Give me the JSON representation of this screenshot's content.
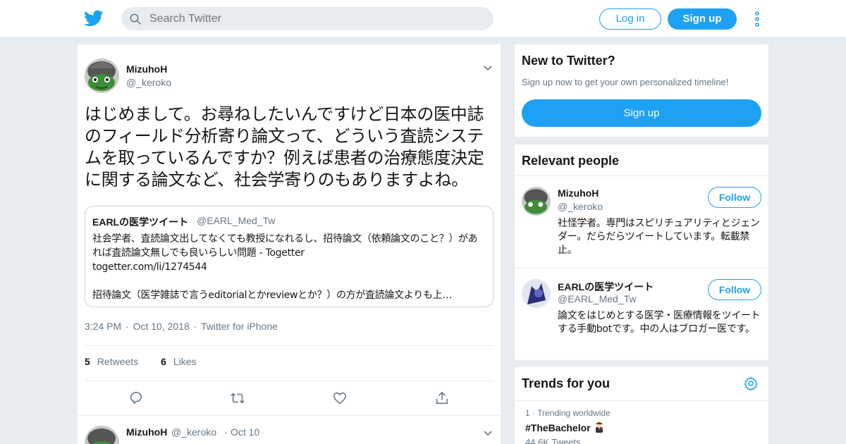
{
  "header": {
    "search_placeholder": "Search Twitter",
    "login_label": "Log in",
    "signup_label": "Sign up"
  },
  "tweet": {
    "author_name": "MizuhoH",
    "author_handle": "@_keroko",
    "text": "はじめまして。お尋ねしたいんですけど日本の医中誌のフィールド分析寄り論文って、どういう査読システムを取っているんですか？例えば患者の治療態度決定に関する論文など、社会学寄りのもありますよね。",
    "quote": {
      "name": "EARLの医学ツイート",
      "handle": "@EARL_Med_Tw",
      "text": "社会学者、査読論文出してなくても教授になれるし、招待論文（依頼論文のこと？）があれば査読論文無しでも良いらしい問題 - Togetter\ntogetter.com/li/1274544\n\n招待論文（医学雑誌で言うeditorialとかreviewとか？）の方が査読論文よりも上…"
    },
    "time": "3:24 PM",
    "date": "Oct 10, 2018",
    "source": "Twitter for iPhone",
    "retweets_count": "5",
    "retweets_label": "Retweets",
    "likes_count": "6",
    "likes_label": "Likes"
  },
  "reply_tweet": {
    "author_name": "MizuhoH",
    "author_handle": "@_keroko",
    "date": "Oct 10"
  },
  "sidebar": {
    "new_to_twitter": {
      "title": "New to Twitter?",
      "subtitle": "Sign up now to get your own personalized timeline!",
      "button": "Sign up"
    },
    "relevant_people": {
      "title": "Relevant people",
      "people": [
        {
          "name": "MizuhoH",
          "handle": "@_keroko",
          "bio": "社怪学者。専門はスピリチュアリティとジェンダー。だらだらツイートしています。転載禁止。",
          "follow_label": "Follow"
        },
        {
          "name": "EARLの医学ツイート",
          "handle": "@EARL_Med_Tw",
          "bio": "論文をはじめとする医学・医療情報をツイートする手動botです。中の人はブロガー医です。",
          "follow_label": "Follow"
        }
      ]
    },
    "trends": {
      "title": "Trends for you",
      "items": [
        {
          "rank": "1 · Trending worldwide",
          "name": "#TheBachelor",
          "count": "44.6K Tweets"
        }
      ]
    }
  },
  "colors": {
    "accent": "#1da1f2",
    "background": "#e6ecf0",
    "secondary_text": "#657786"
  }
}
